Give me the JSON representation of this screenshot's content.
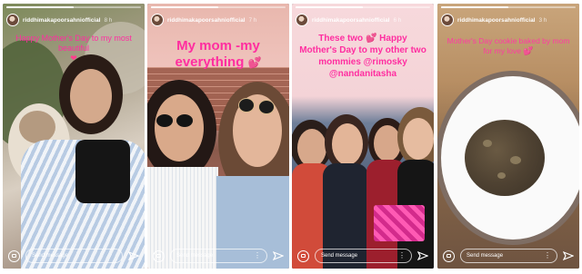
{
  "stories": [
    {
      "username": "riddhimakapoorsahniofficial",
      "time_ago": "8 h",
      "caption": "Happy Mother's Day to my most beautiful",
      "emoji_icon": "heart-icon",
      "progress": 0.5,
      "message_placeholder": "Send message"
    },
    {
      "username": "riddhimakapoorsahniofficial",
      "time_ago": "7 h",
      "caption": "My mom -my everything",
      "emoji_icon": "heart-icon",
      "progress": 0.5,
      "message_placeholder": "Send message"
    },
    {
      "username": "riddhimakapoorsahniofficial",
      "time_ago": "6 h",
      "caption": "These two 💕 Happy Mother's Day to my other two mommies @rimosky @nandanitasha",
      "emoji_icon": "heart-icon",
      "progress": 0.5,
      "message_placeholder": "Send message"
    },
    {
      "username": "riddhimakapoorsahniofficial",
      "time_ago": "3 h",
      "caption": "Mother's Day cookie baked by mom for my love",
      "emoji_icon": "heart-icon",
      "progress": 0.5,
      "message_placeholder": "Send message"
    }
  ],
  "colors": {
    "caption_pink": "#ff2ea0",
    "caption_magenta_bold": "#f02d9c"
  }
}
